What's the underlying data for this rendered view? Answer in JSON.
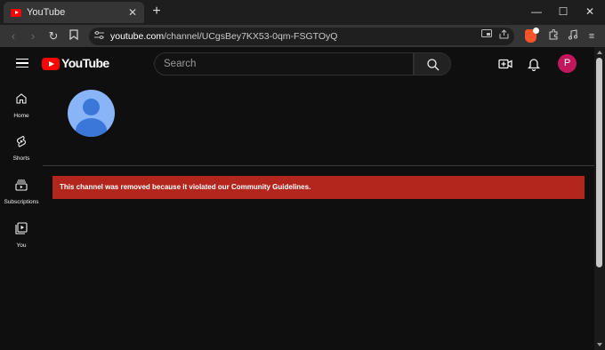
{
  "browser": {
    "tab_title": "YouTube",
    "tab_close": "✕",
    "new_tab": "+",
    "address_host": "youtube.com",
    "address_path": "/channel/UCgsBey7KX53-0qm-FSGTOyQ",
    "window_controls": {
      "minimize": "—",
      "maximize": "☐",
      "close": "✕"
    },
    "nav_icons": {
      "back": "‹",
      "forward": "›",
      "reload": "↻",
      "bookmark": "bookmark-icon"
    },
    "extensions": {
      "puzzle": "puzzle-icon",
      "media": "music-icon",
      "menu": "≡"
    }
  },
  "youtube": {
    "logo_text": "YouTube",
    "search_placeholder": "Search",
    "account_initial": "P",
    "guide": [
      {
        "label": "Home",
        "icon": "home-icon"
      },
      {
        "label": "Shorts",
        "icon": "shorts-icon"
      },
      {
        "label": "Subscriptions",
        "icon": "subscriptions-icon"
      },
      {
        "label": "You",
        "icon": "you-icon"
      }
    ],
    "removed_message": "This channel was removed because it violated our Community Guidelines."
  },
  "colors": {
    "brand_red": "#ff0000",
    "banner_red": "#b3261e",
    "avatar_pink": "#c2185b",
    "default_avatar_light": "#8ab4f8",
    "default_avatar_dark": "#3b77d9"
  }
}
